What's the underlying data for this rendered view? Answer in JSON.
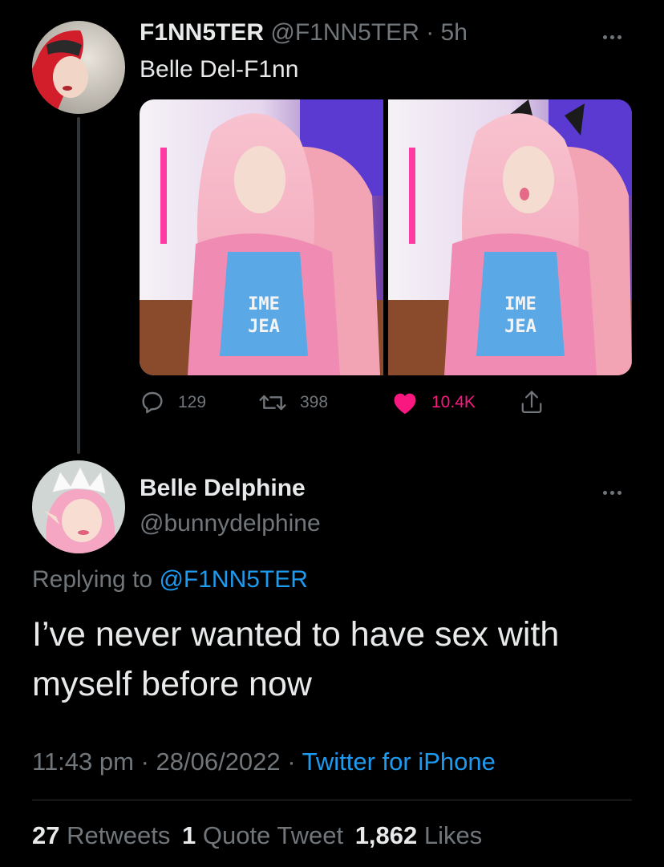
{
  "first_tweet": {
    "display_name": "F1NN5TER",
    "handle_time": "@F1NN5TER · 5h",
    "text": "Belle Del-F1nn",
    "actions": {
      "replies": "129",
      "retweets": "398",
      "likes": "10.4K"
    }
  },
  "main_tweet": {
    "display_name": "Belle Delphine",
    "handle": "@bunnydelphine",
    "replying_prefix": "Replying to ",
    "replying_handle": "@F1NN5TER",
    "text_line1": "I’ve never wanted to have sex with",
    "text_line2": "myself before now",
    "time_date": "11:43 pm · 28/06/2022 · ",
    "source": "Twitter for iPhone",
    "stats": {
      "retweets_count": "27",
      "retweets_label": "Retweets",
      "quotes_count": "1",
      "quotes_label": "Quote Tweet",
      "likes_count": "1,862",
      "likes_label": "Likes"
    }
  },
  "colors": {
    "background": "#000000",
    "link": "#1d9bf0",
    "like_active": "#f91880",
    "muted": "#71767b"
  }
}
